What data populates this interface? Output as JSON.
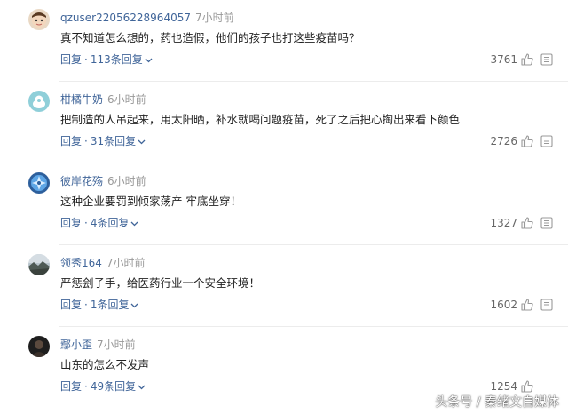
{
  "comments": [
    {
      "username": "qzuser22056228964057",
      "time": "7小时前",
      "text": "真不知道怎么想的，药也造假，他们的孩子也打这些疫苗吗？",
      "reply_label": "回复",
      "replies_label": "113条回复",
      "likes": "3761",
      "avatar": "child-photo"
    },
    {
      "username": "柑橘牛奶",
      "time": "6小时前",
      "text": "把制造的人吊起来，用太阳晒，补水就喝问题疫苗，死了之后把心掏出来看下颜色",
      "reply_label": "回复",
      "replies_label": "31条回复",
      "likes": "2726",
      "avatar": "default-bird"
    },
    {
      "username": "彼岸花殇",
      "time": "6小时前",
      "text": "这种企业要罚到倾家荡产 牢底坐穿！",
      "reply_label": "回复",
      "replies_label": "4条回复",
      "likes": "1327",
      "avatar": "blue-flower"
    },
    {
      "username": "领秀164",
      "time": "7小时前",
      "text": "严惩刽子手，给医药行业一个安全环境！",
      "reply_label": "回复",
      "replies_label": "1条回复",
      "likes": "1602",
      "avatar": "landscape"
    },
    {
      "username": "鄢小歪",
      "time": "7小时前",
      "text": "山东的怎么不发声",
      "reply_label": "回复",
      "replies_label": "49条回复",
      "likes": "1254",
      "avatar": "dark-portrait"
    }
  ],
  "watermark": "头条号 / 秦绪文自媒体",
  "colors": {
    "username": "#406599",
    "time": "#999999",
    "text": "#222222",
    "divider": "#ececec"
  }
}
